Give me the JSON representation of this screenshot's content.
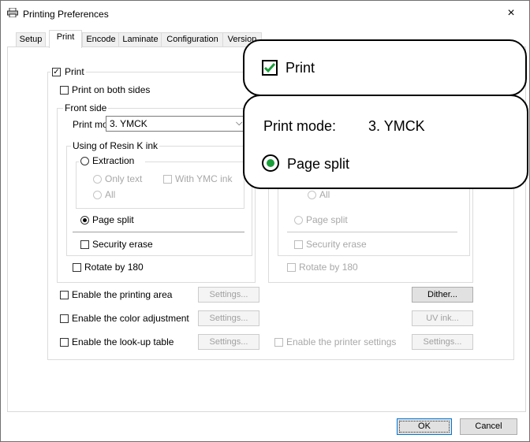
{
  "window": {
    "title": "Printing Preferences",
    "close": "×"
  },
  "tabs": [
    "Setup",
    "Print",
    "Encode",
    "Laminate",
    "Configuration",
    "Version"
  ],
  "print_section": {
    "print_label": "Print",
    "both_sides_label": "Print on both sides",
    "front_side_label": "Front side",
    "print_mode_label": "Print mode:",
    "print_mode_value": "3. YMCK",
    "resin_label": "Using of Resin K ink",
    "extraction_label": "Extraction",
    "only_text_label": "Only text",
    "with_ymc_label": "With YMC ink",
    "all_label": "All",
    "page_split_label": "Page split",
    "security_erase_label": "Security erase",
    "rotate_label": "Rotate by 180"
  },
  "back_side": {
    "all_label": "All",
    "page_split_label": "Page split",
    "security_erase_label": "Security erase",
    "rotate_label": "Rotate by 180"
  },
  "options": {
    "printing_area_label": "Enable the printing area",
    "color_adjust_label": "Enable the color adjustment",
    "lookup_label": "Enable the look-up table",
    "printer_settings_label": "Enable the printer settings",
    "settings_label": "Settings...",
    "dither_label": "Dither...",
    "uv_ink_label": "UV ink..."
  },
  "footer": {
    "ok": "OK",
    "cancel": "Cancel"
  },
  "callouts": {
    "print_label": "Print",
    "print_mode_label": "Print mode:",
    "print_mode_value": "3. YMCK",
    "page_split_label": "Page split",
    "check_color": "#1a9e3a"
  }
}
